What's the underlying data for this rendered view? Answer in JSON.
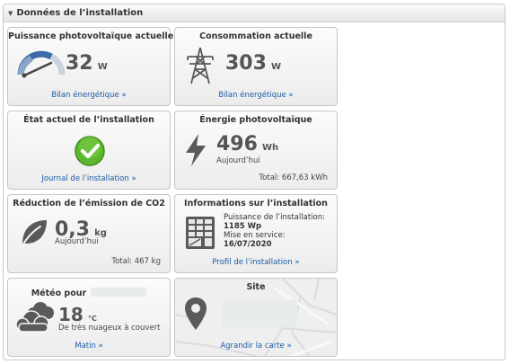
{
  "panel": {
    "title": "Données de l’installation"
  },
  "tiles": {
    "pv_power": {
      "title": "Puissance photovoltaïque actuelle",
      "value": "32",
      "unit": "W",
      "link": "Bilan énergétique »"
    },
    "consumption": {
      "title": "Consommation actuelle",
      "value": "303",
      "unit": "W",
      "link": "Bilan énergétique »"
    },
    "status": {
      "title": "État actuel de l’installation",
      "link": "Journal de l’installation »"
    },
    "pv_energy": {
      "title": "Énergie photovoltaïque",
      "value": "496",
      "unit": "Wh",
      "period": "Aujourd’hui",
      "total": "Total: 667,63 kWh"
    },
    "co2": {
      "title": "Réduction de l’émission de CO2",
      "value": "0,3",
      "unit": "kg",
      "period": "Aujourd’hui",
      "total": "Total: 467 kg"
    },
    "info": {
      "title": "Informations sur l’installation",
      "power_label": "Puissance de l’installation:",
      "power_value": "1185 Wp",
      "service_label": "Mise en service:",
      "service_value": "16/07/2020",
      "link": "Profil de l’installation »"
    },
    "weather": {
      "title": "Météo pour",
      "temp": "18",
      "unit": "°C",
      "desc": "De très nuageux à couvert",
      "link": "Matin »"
    },
    "site": {
      "title": "Site",
      "link": "Agrandir la carte »"
    }
  },
  "colors": {
    "link": "#1a5aa6",
    "ok_green": "#5cb82c",
    "icon_gray": "#5a5a5a",
    "gauge_blue": "#3d6aa8"
  }
}
